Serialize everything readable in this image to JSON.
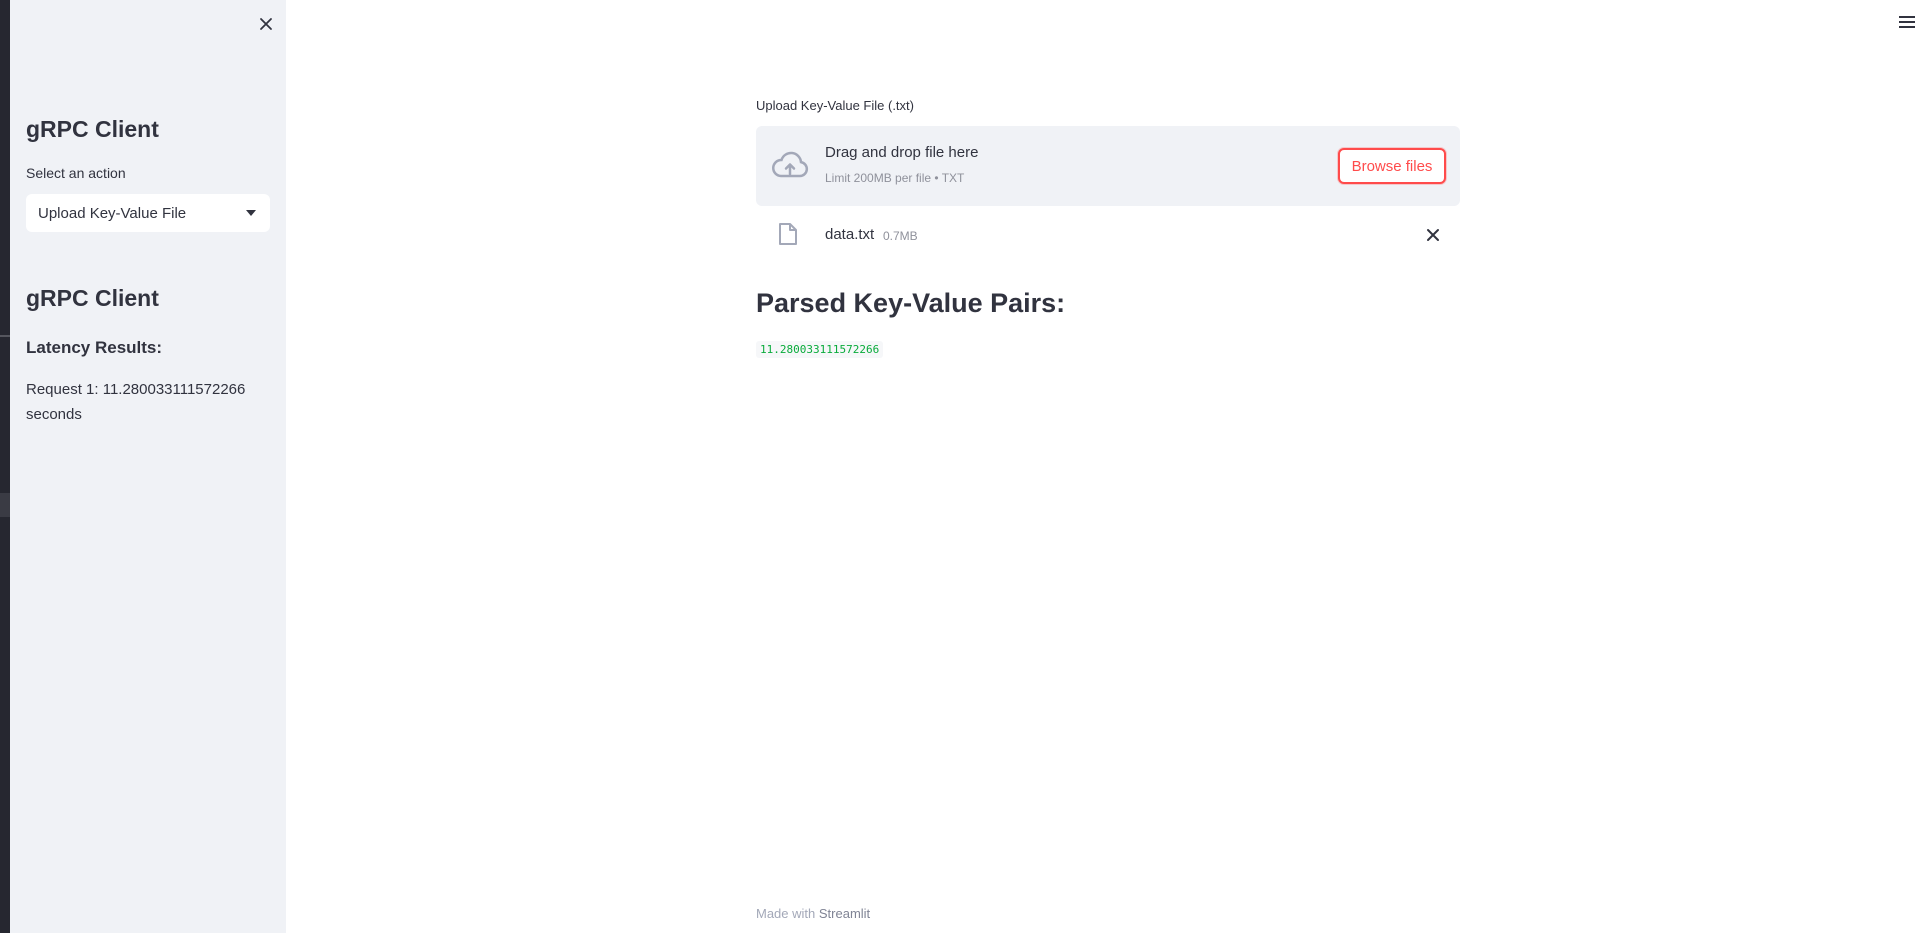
{
  "sidebar": {
    "title_primary": "gRPC Client",
    "select_label": "Select an action",
    "selected_action": "Upload Key-Value File",
    "title_secondary": "gRPC Client",
    "latency_title": "Latency Results:",
    "latency_line": "Request 1: 11.280033111572266 seconds"
  },
  "uploader": {
    "label": "Upload Key-Value File (.txt)",
    "drop_title": "Drag and drop file here",
    "drop_subtitle": "Limit 200MB per file • TXT",
    "browse_label": "Browse files"
  },
  "uploaded_file": {
    "name": "data.txt",
    "size": "0.7MB"
  },
  "main": {
    "section_title": "Parsed Key-Value Pairs:",
    "code_value": "11.280033111572266"
  },
  "footer": {
    "made_with": "Made with",
    "brand": "Streamlit"
  },
  "colors": {
    "accent": "#ff4b4b",
    "sidebar_bg": "#f0f2f6",
    "text": "#31333f",
    "code_green": "#09ab3b"
  },
  "icons": {
    "sidebar_close": "close-icon",
    "menu": "hamburger-menu-icon",
    "upload": "cloud-upload-icon",
    "file": "file-icon",
    "remove": "close-icon",
    "select_caret": "caret-down-icon"
  }
}
